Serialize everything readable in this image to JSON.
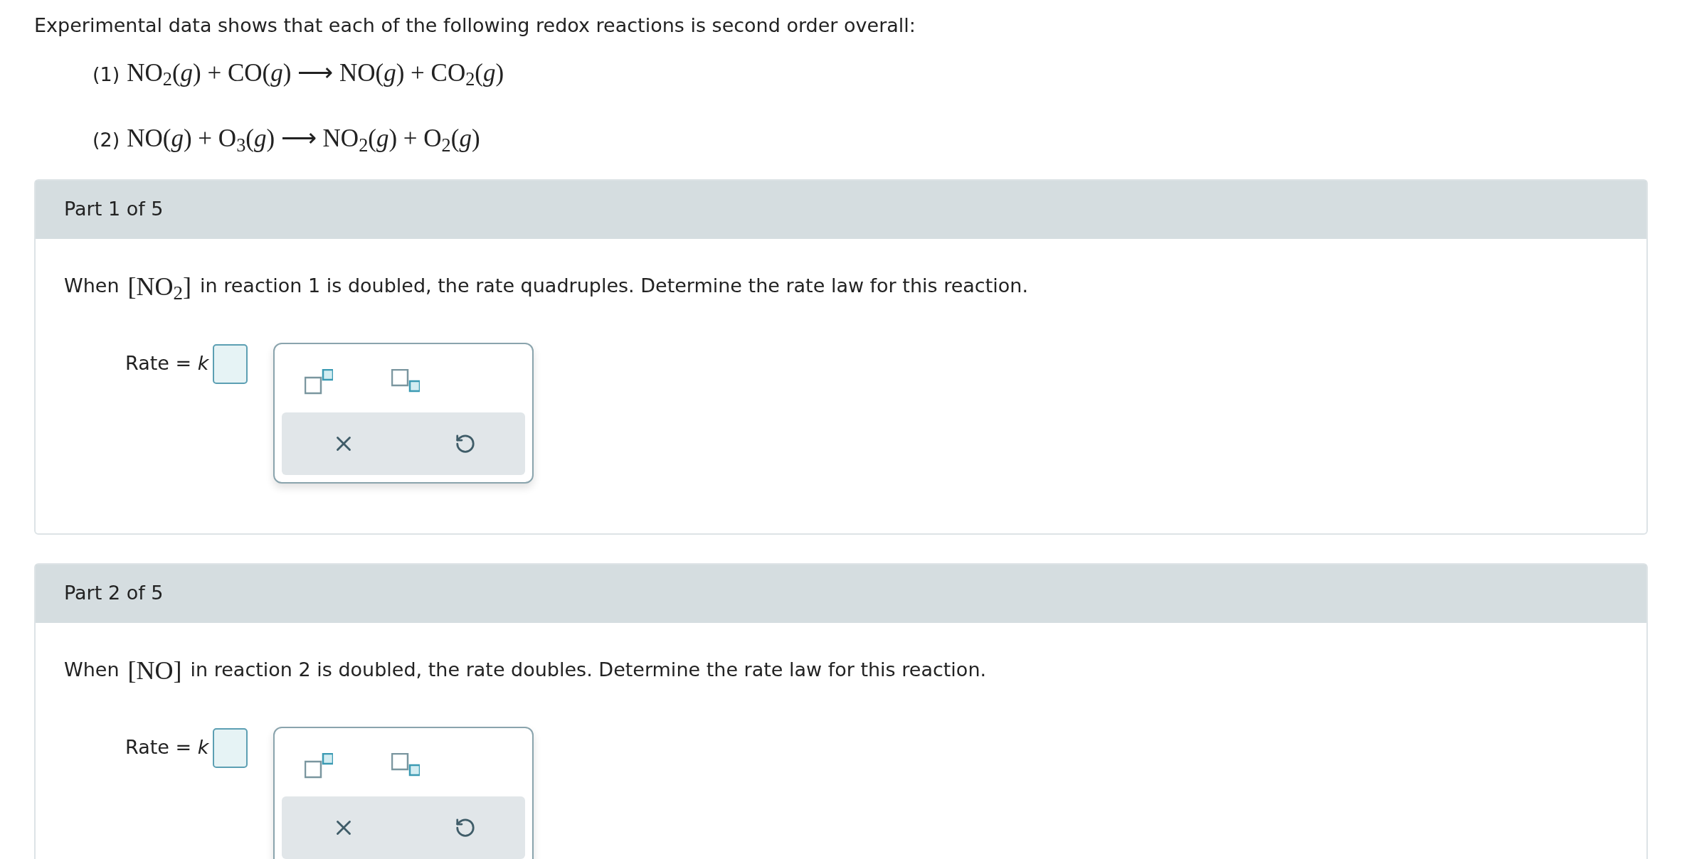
{
  "intro": "Experimental data shows that each of the following redox reactions is second order overall:",
  "equations": [
    {
      "number": "(1)",
      "equation": "NO$_{2}$(*g*) + CO(*g*) ⟶ NO(*g*) + CO$_{2}$(*g*)"
    },
    {
      "number": "(2)",
      "equation": "NO(*g*) + O$_{3}$(*g*) ⟶ NO$_{2}$(*g*) + O$_{2}$(*g*)"
    }
  ],
  "parts": [
    {
      "header": "Part 1 of 5",
      "question_start": "When",
      "species": "[NO$_{2}$]",
      "question_end": "in reaction 1 is doubled, the rate quadruples. Determine the rate law for this reaction.",
      "rate_label": "Rate = *k*"
    },
    {
      "header": "Part 2 of 5",
      "question_start": "When",
      "species": "[NO]",
      "question_end": "in reaction 2 is doubled, the rate doubles. Determine the rate law for this reaction.",
      "rate_label": "Rate = *k*"
    }
  ]
}
